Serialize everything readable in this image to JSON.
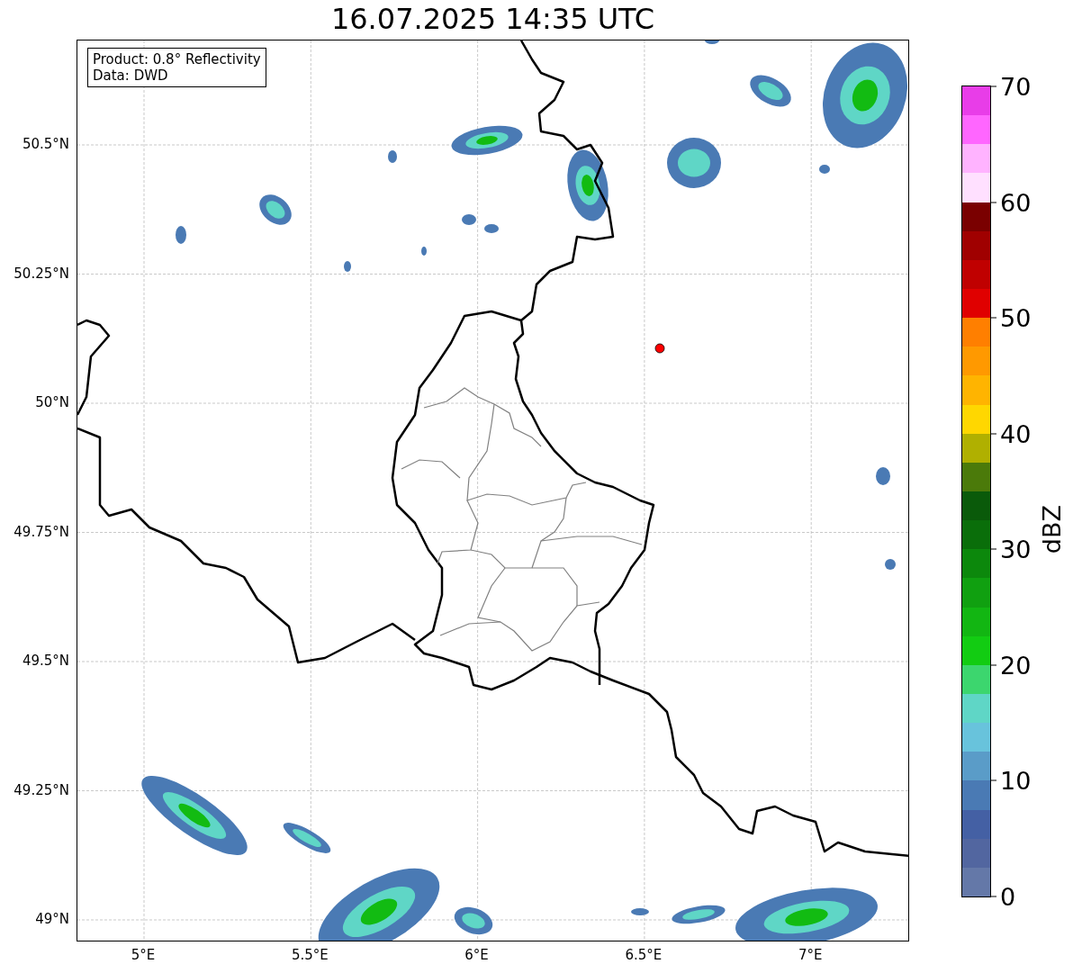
{
  "title": "16.07.2025 14:35 UTC",
  "legend": {
    "lines": [
      "Product: 0.8° Reflectivity",
      "Data: DWD"
    ]
  },
  "y_ticks": [
    "50.5°N",
    "50.25°N",
    "50°N",
    "49.75°N",
    "49.5°N",
    "49.25°N",
    "49°N"
  ],
  "x_ticks": [
    "5°E",
    "5.5°E",
    "6°E",
    "6.5°E",
    "7°E"
  ],
  "colorbar": {
    "label": "dBZ",
    "ticks": [
      "70",
      "60",
      "50",
      "40",
      "30",
      "20",
      "10",
      "0"
    ],
    "segments": [
      {
        "color": "#e83de8"
      },
      {
        "color": "#ff66ff"
      },
      {
        "color": "#ffb3ff"
      },
      {
        "color": "#ffe0ff"
      },
      {
        "color": "#7a0000"
      },
      {
        "color": "#a00000"
      },
      {
        "color": "#c00000"
      },
      {
        "color": "#e00000"
      },
      {
        "color": "#ff7f00"
      },
      {
        "color": "#ff9900"
      },
      {
        "color": "#ffb400"
      },
      {
        "color": "#ffd700"
      },
      {
        "color": "#b0b000"
      },
      {
        "color": "#4b7a0a"
      },
      {
        "color": "#0a5a0a"
      },
      {
        "color": "#0a6e0a"
      },
      {
        "color": "#0c880c"
      },
      {
        "color": "#10a010"
      },
      {
        "color": "#12b612"
      },
      {
        "color": "#12cc12"
      },
      {
        "color": "#3cd66e"
      },
      {
        "color": "#5fd6c6"
      },
      {
        "color": "#68c3dc"
      },
      {
        "color": "#5a9cc8"
      },
      {
        "color": "#4a7ab4"
      },
      {
        "color": "#4460a4"
      },
      {
        "color": "#5266a0"
      },
      {
        "color": "#6478a8"
      }
    ]
  }
}
